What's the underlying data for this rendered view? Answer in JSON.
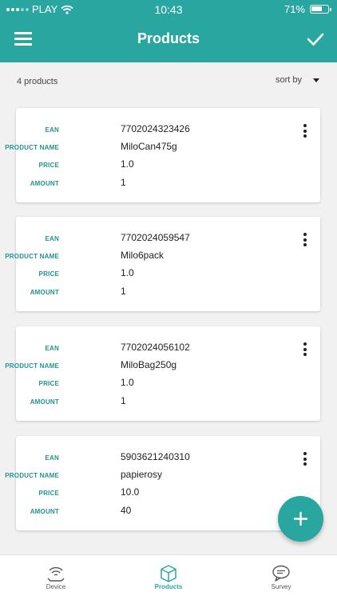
{
  "status_bar": {
    "carrier": "PLAY",
    "time": "10:43",
    "battery": "71%",
    "battery_level": 0.71
  },
  "header": {
    "title": "Products",
    "menu_icon": "hamburger-menu-icon",
    "confirm_icon": "checkmark-icon"
  },
  "toolbar": {
    "count": "4 products",
    "sort_label": "sort by"
  },
  "labels": {
    "ean": "EAN",
    "product_name": "PRODUCT NAME",
    "price": "PRICE",
    "amount": "AMOUNT"
  },
  "products": [
    {
      "ean": "7702024323426",
      "name": "MiloCan475g",
      "price": "1.0",
      "amount": "1"
    },
    {
      "ean": "7702024059547",
      "name": "Milo6pack",
      "price": "1.0",
      "amount": "1"
    },
    {
      "ean": "7702024056102",
      "name": "MiloBag250g",
      "price": "1.0",
      "amount": "1"
    },
    {
      "ean": "5903621240310",
      "name": "papierosy",
      "price": "10.0",
      "amount": "40"
    }
  ],
  "fab": {
    "icon": "plus-icon"
  },
  "bottom_nav": [
    {
      "label": "Device",
      "icon": "wifi-device-icon",
      "active": false
    },
    {
      "label": "Products",
      "icon": "box-icon",
      "active": true
    },
    {
      "label": "Survey",
      "icon": "chat-bubble-icon",
      "active": false
    }
  ],
  "colors": {
    "accent": "#2aa6a1",
    "label": "#21948f",
    "background": "#f1f1f1"
  }
}
